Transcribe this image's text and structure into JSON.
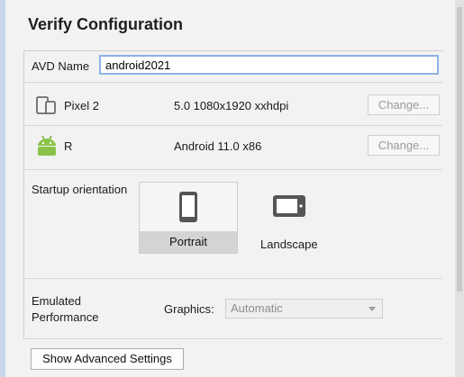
{
  "title": "Verify Configuration",
  "avd": {
    "label": "AVD Name",
    "value": "android2021"
  },
  "device": {
    "name": "Pixel 2",
    "spec": "5.0 1080x1920 xxhdpi",
    "change_label": "Change..."
  },
  "system_image": {
    "name": "R",
    "spec": "Android 11.0 x86",
    "change_label": "Change..."
  },
  "orientation": {
    "label": "Startup orientation",
    "portrait": "Portrait",
    "landscape": "Landscape",
    "selected": "Portrait"
  },
  "performance": {
    "label_line1": "Emulated",
    "label_line2": "Performance",
    "graphics_label": "Graphics:",
    "graphics_value": "Automatic"
  },
  "advanced_button": "Show Advanced Settings"
}
